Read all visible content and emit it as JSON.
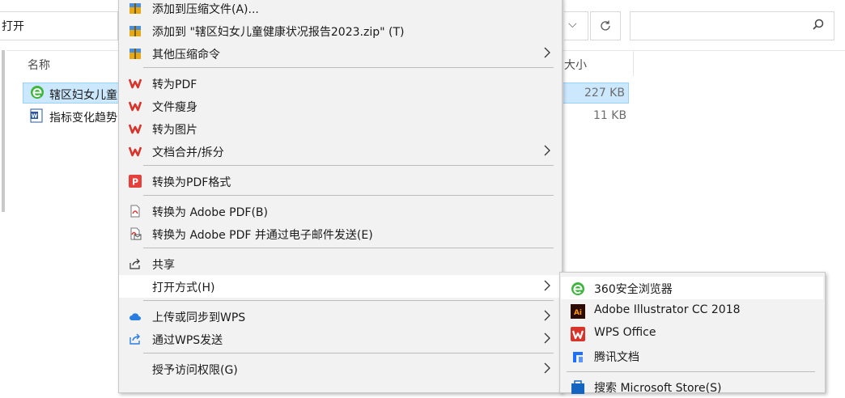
{
  "explorer": {
    "address_text": "打开",
    "chevron": "⌵",
    "column_name": "名称",
    "column_size": "大小",
    "files": [
      {
        "name": "辖区妇女儿童",
        "size": "227 KB",
        "icon": "360-browser-icon",
        "selected": true
      },
      {
        "name": "指标变化趋势",
        "size": "11 KB",
        "icon": "word-doc-icon",
        "selected": false
      }
    ]
  },
  "context_menu": {
    "items": [
      {
        "label": "添加到压缩文件(A)...",
        "icon": "archive-icon"
      },
      {
        "label": "添加到 \"辖区妇女儿童健康状况报告2023.zip\" (T)",
        "icon": "archive-icon"
      },
      {
        "label": "其他压缩命令",
        "icon": "archive-icon",
        "submenu": true
      },
      {
        "label": "转为PDF",
        "icon": "wps-icon"
      },
      {
        "label": "文件瘦身",
        "icon": "wps-icon"
      },
      {
        "label": "转为图片",
        "icon": "wps-icon"
      },
      {
        "label": "文档合并/拆分",
        "icon": "wps-icon",
        "submenu": true
      },
      {
        "label": "转换为PDF格式",
        "icon": "pdf-convert-icon"
      },
      {
        "label": "转换为 Adobe PDF(B)",
        "icon": "adobe-pdf-icon"
      },
      {
        "label": "转换为 Adobe PDF 并通过电子邮件发送(E)",
        "icon": "adobe-pdf-mail-icon"
      },
      {
        "label": "共享",
        "icon": "share-icon"
      },
      {
        "label": "打开方式(H)",
        "icon": "",
        "submenu": true
      },
      {
        "label": "上传或同步到WPS",
        "icon": "cloud-icon",
        "submenu": true
      },
      {
        "label": "通过WPS发送",
        "icon": "send-icon",
        "submenu": true
      },
      {
        "label": "授予访问权限(G)",
        "icon": "",
        "submenu": true
      }
    ]
  },
  "open_with_menu": {
    "items": [
      {
        "label": "360安全浏览器",
        "icon": "360-browser-icon"
      },
      {
        "label": "Adobe Illustrator CC 2018",
        "icon": "illustrator-icon"
      },
      {
        "label": "WPS Office",
        "icon": "wps-icon"
      },
      {
        "label": "腾讯文档",
        "icon": "tencent-docs-icon"
      },
      {
        "label": "搜索 Microsoft Store(S)",
        "icon": "store-icon"
      }
    ]
  },
  "colors": {
    "selection": "#cce8ff",
    "menu_bg": "#f2f2f2",
    "wps_red": "#d9342b",
    "highlight": "#ffffff"
  }
}
